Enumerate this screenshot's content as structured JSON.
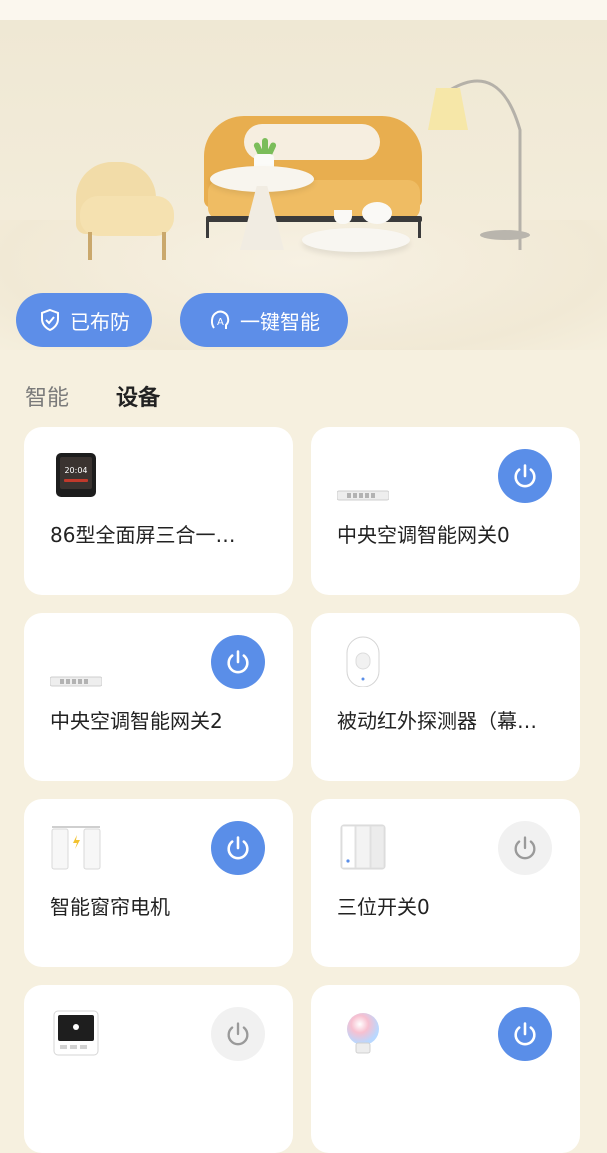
{
  "actions": {
    "armed": {
      "label": "已布防",
      "icon": "shield-check-icon"
    },
    "smart": {
      "label": "一键智能",
      "icon": "smart-a-icon"
    }
  },
  "tabs": [
    {
      "label": "智能",
      "active": false
    },
    {
      "label": "设备",
      "active": true
    }
  ],
  "colors": {
    "accent": "#5d8ee8",
    "background": "#f6f0df",
    "card": "#ffffff"
  },
  "devices": [
    {
      "name": "86型全面屏三合一…",
      "icon": "touch-panel-icon",
      "power": "none",
      "panel_time": "20:04"
    },
    {
      "name": "中央空调智能网关0",
      "icon": "gateway-icon",
      "power": "on"
    },
    {
      "name": "中央空调智能网关2",
      "icon": "gateway-icon",
      "power": "on"
    },
    {
      "name": "被动红外探测器（幕…",
      "icon": "motion-sensor-icon",
      "power": "none"
    },
    {
      "name": "智能窗帘电机",
      "icon": "curtain-motor-icon",
      "power": "on"
    },
    {
      "name": "三位开关0",
      "icon": "triple-switch-icon",
      "power": "off"
    },
    {
      "name": "",
      "icon": "smart-panel-icon",
      "power": "off"
    },
    {
      "name": "",
      "icon": "smart-bulb-icon",
      "power": "on"
    }
  ]
}
